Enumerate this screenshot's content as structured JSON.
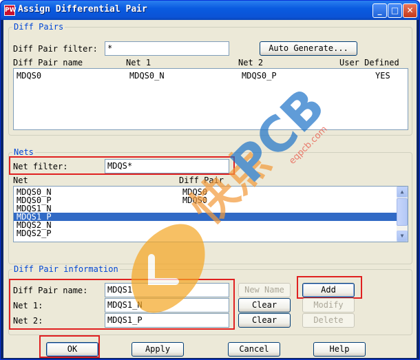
{
  "window": {
    "title": "Assign Differential Pair",
    "icon_text": "PW"
  },
  "diff_pairs": {
    "legend": "Diff Pairs",
    "filter_label": "Diff Pair filter:",
    "filter_value": "*",
    "auto_generate_label": "Auto Generate...",
    "columns": [
      "Diff Pair name",
      "Net 1",
      "Net 2",
      "User Defined"
    ],
    "rows": [
      {
        "name": "MDQS0",
        "net1": "MDQS0_N",
        "net2": "MDQS0_P",
        "user_defined": "YES"
      }
    ]
  },
  "nets": {
    "legend": "Nets",
    "filter_label": "Net filter:",
    "filter_value": "MDQS*",
    "columns": [
      "Net",
      "Diff Pair"
    ],
    "rows": [
      {
        "net": "MDQS0_N",
        "pair": "MDQS0"
      },
      {
        "net": "MDQS0_P",
        "pair": "MDQS0"
      },
      {
        "net": "MDQS1_N",
        "pair": ""
      },
      {
        "net": "MDQS1_P",
        "pair": ""
      },
      {
        "net": "MDQS2_N",
        "pair": ""
      },
      {
        "net": "MDQS2_P",
        "pair": ""
      }
    ],
    "selected_index": 3
  },
  "info": {
    "legend": "Diff Pair information",
    "name_label": "Diff Pair name:",
    "name_value": "MDQS1",
    "net1_label": "Net 1:",
    "net1_value": "MDQS1_N",
    "net2_label": "Net 2:",
    "net2_value": "MDQS1_P",
    "new_name_label": "New Name",
    "clear1_label": "Clear",
    "clear2_label": "Clear",
    "add_label": "Add",
    "modify_label": "Modify",
    "delete_label": "Delete"
  },
  "footer": {
    "ok": "OK",
    "apply": "Apply",
    "cancel": "Cancel",
    "help": "Help"
  },
  "watermark": {
    "brand_text": "PCB",
    "cn_text": "快点",
    "url_text": "eqpcb.com"
  },
  "colors": {
    "accent": "#0046d5",
    "highlight": "#e02020",
    "selection": "#316ac5"
  }
}
